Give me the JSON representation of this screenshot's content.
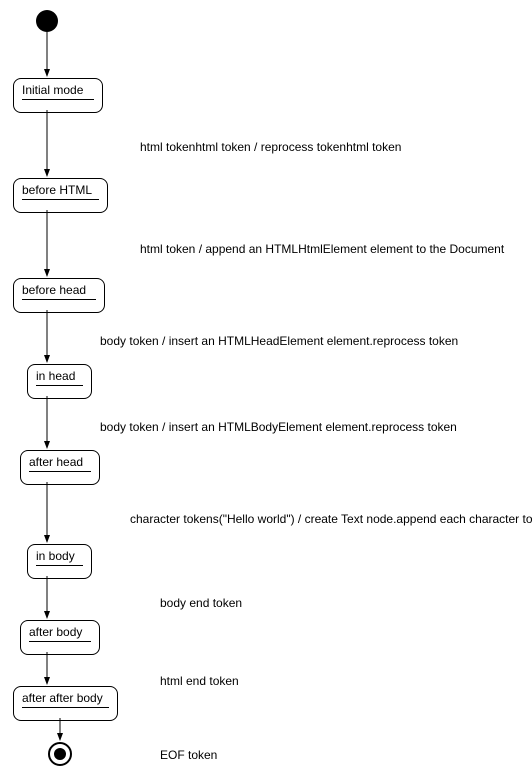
{
  "chart_data": {
    "type": "state-diagram",
    "start_node": true,
    "end_node": true,
    "states": [
      {
        "id": "initial",
        "label": "Initial mode"
      },
      {
        "id": "before_html",
        "label": "before HTML"
      },
      {
        "id": "before_head",
        "label": "before head"
      },
      {
        "id": "in_head",
        "label": "in head"
      },
      {
        "id": "after_head",
        "label": "after head"
      },
      {
        "id": "in_body",
        "label": "in body"
      },
      {
        "id": "after_body",
        "label": "after body"
      },
      {
        "id": "after_after_body",
        "label": "after after body"
      }
    ],
    "transitions": [
      {
        "from": "start",
        "to": "initial",
        "label": ""
      },
      {
        "from": "initial",
        "to": "before_html",
        "label": "html tokenhtml token / reprocess tokenhtml token"
      },
      {
        "from": "before_html",
        "to": "before_head",
        "label": "html token / append an HTMLHtmlElement element to the Document"
      },
      {
        "from": "before_head",
        "to": "in_head",
        "label": "body token / insert an HTMLHeadElement element.reprocess token"
      },
      {
        "from": "in_head",
        "to": "after_head",
        "label": "body token / insert an HTMLBodyElement element.reprocess token"
      },
      {
        "from": "after_head",
        "to": "in_body",
        "label": "character tokens(\"Hello world\") / create Text node.append each character to it."
      },
      {
        "from": "in_body",
        "to": "after_body",
        "label": "body end token"
      },
      {
        "from": "after_body",
        "to": "after_after_body",
        "label": "html end token"
      },
      {
        "from": "after_after_body",
        "to": "end",
        "label": "EOF token"
      }
    ]
  }
}
